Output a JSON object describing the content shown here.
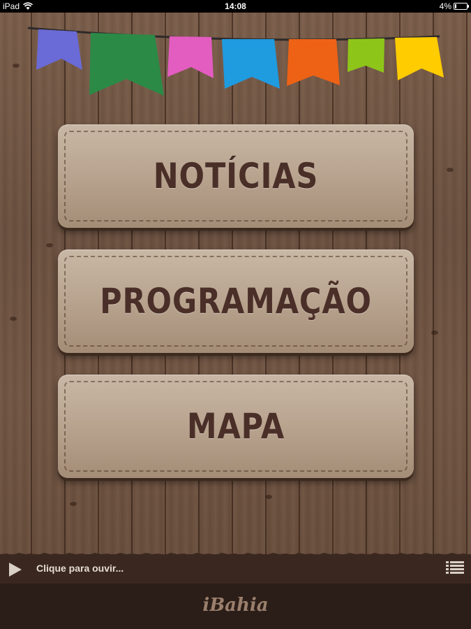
{
  "status_bar": {
    "carrier": "iPad",
    "time": "14:08",
    "battery": "4%"
  },
  "bunting": {
    "flag_colors": [
      "#6a6bd6",
      "#2c8a47",
      "#e35cc0",
      "#1f9be0",
      "#ee6215",
      "#8dc619",
      "#ffcc00"
    ]
  },
  "menu": {
    "items": [
      {
        "label": "NOTÍCIAS"
      },
      {
        "label": "PROGRAMAÇÃO"
      },
      {
        "label": "MAPA"
      }
    ]
  },
  "player": {
    "play_icon": "play-icon",
    "hint": "Clique para ouvir...",
    "list_icon": "list-icon"
  },
  "footer": {
    "logo_text": "iBahia"
  },
  "colors": {
    "button_text": "#4a2f28",
    "footer_bg": "#2b1d17",
    "player_bg": "#3a2820"
  }
}
